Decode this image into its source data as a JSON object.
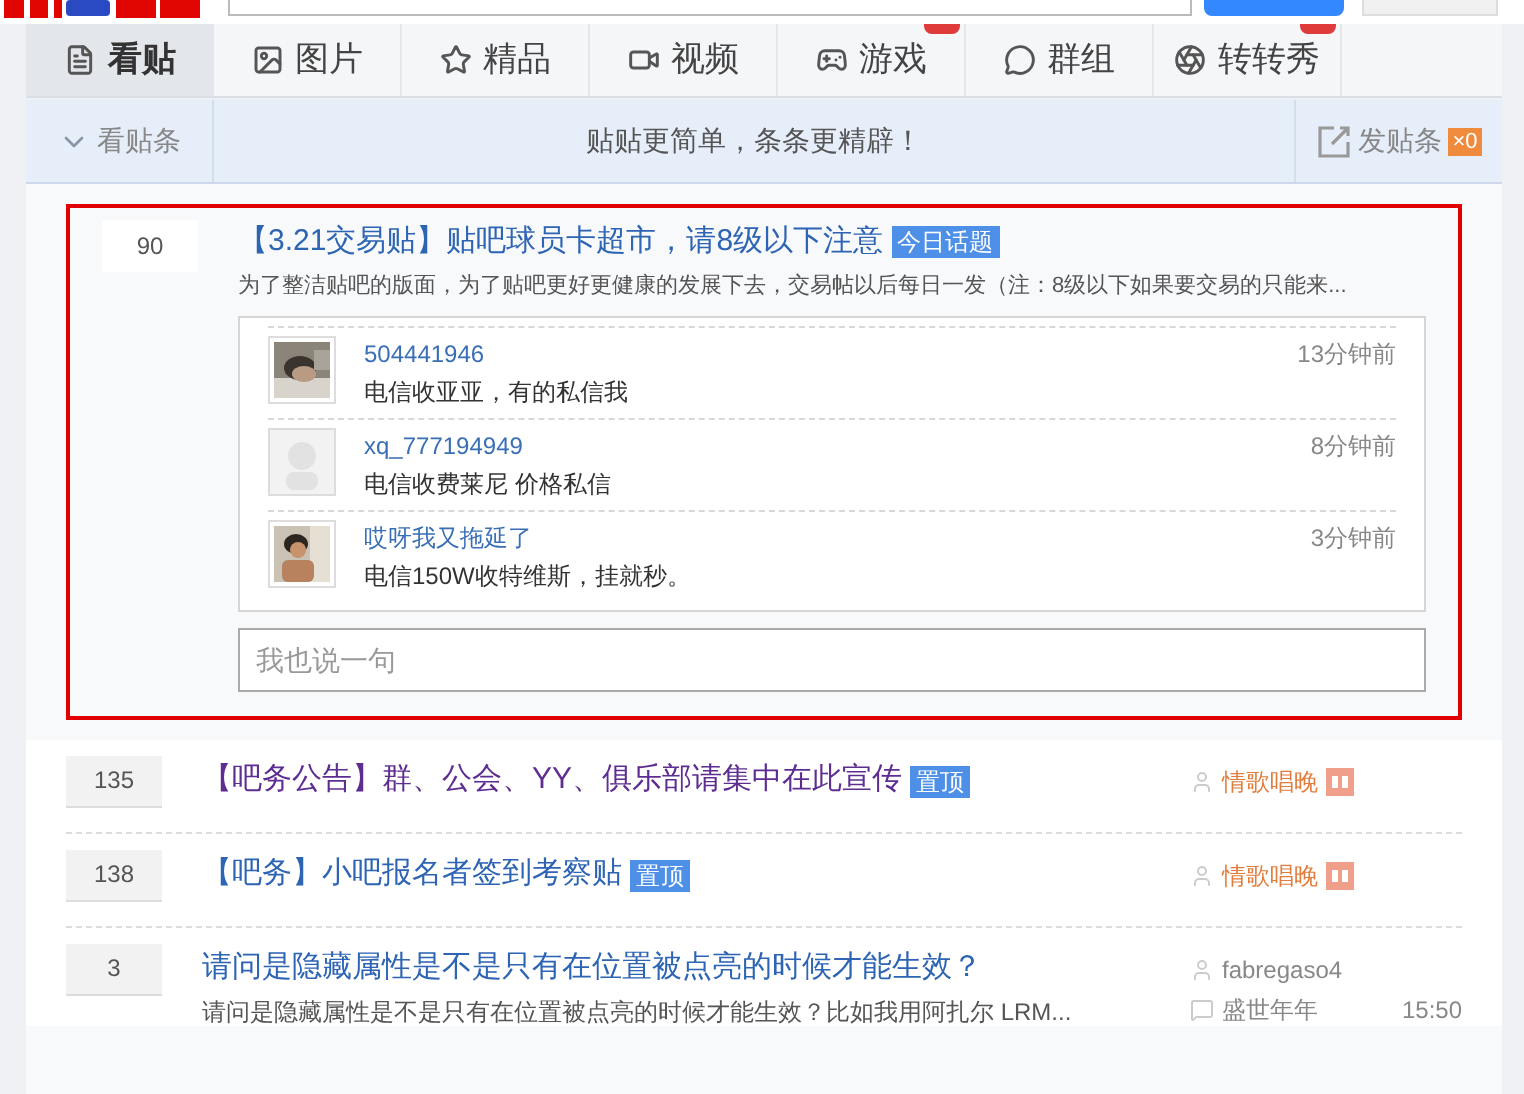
{
  "tabs": [
    {
      "label": "看贴",
      "selected": true,
      "new_badge": false
    },
    {
      "label": "图片",
      "selected": false,
      "new_badge": false
    },
    {
      "label": "精品",
      "selected": false,
      "new_badge": false
    },
    {
      "label": "视频",
      "selected": false,
      "new_badge": false
    },
    {
      "label": "游戏",
      "selected": false,
      "new_badge": true
    },
    {
      "label": "群组",
      "selected": false,
      "new_badge": false
    },
    {
      "label": "转转秀",
      "selected": false,
      "new_badge": true
    }
  ],
  "toolbar": {
    "left": "看贴条",
    "slogan": "贴贴更简单，条条更精辟！",
    "right": "发贴条",
    "count": "×0"
  },
  "expanded_post": {
    "replies": "90",
    "title": "【3.21交易贴】贴吧球员卡超市，请8级以下注意",
    "tag": "今日话题",
    "summary": "为了整洁贴吧的版面，为了贴吧更好更健康的发展下去，交易帖以后每日一发（注：8级以下如果要交易的只能来...",
    "comments": [
      {
        "user": "504441946",
        "text": "电信收亚亚，有的私信我",
        "time": "13分钟前"
      },
      {
        "user": "xq_777194949",
        "text": "电信收费莱尼 价格私信",
        "time": "8分钟前",
        "kind": "default"
      },
      {
        "user": "哎呀我又拖延了",
        "text": "电信150W收特维斯，挂就秒。",
        "time": "3分钟前"
      }
    ],
    "reply_placeholder": "我也说一句"
  },
  "posts": [
    {
      "replies": "135",
      "title": "【吧务公告】群、公会、YY、俱乐部请集中在此宣传",
      "tag": "置顶",
      "visited": true,
      "author": "情歌唱晚",
      "author_level": true
    },
    {
      "replies": "138",
      "title": "【吧务】小吧报名者签到考察贴",
      "tag": "置顶",
      "visited": false,
      "author": "情歌唱晚",
      "author_level": true
    },
    {
      "replies": "3",
      "title": "请问是隐藏属性是不是只有在位置被点亮的时候才能生效？",
      "visited": false,
      "summary": "请问是隐藏属性是不是只有在位置被点亮的时候才能生效？比如我用阿扎尔 LRM...",
      "author": "fabregaso4",
      "author_level": false,
      "last_reply": "盛世年年",
      "time": "15:50"
    }
  ]
}
